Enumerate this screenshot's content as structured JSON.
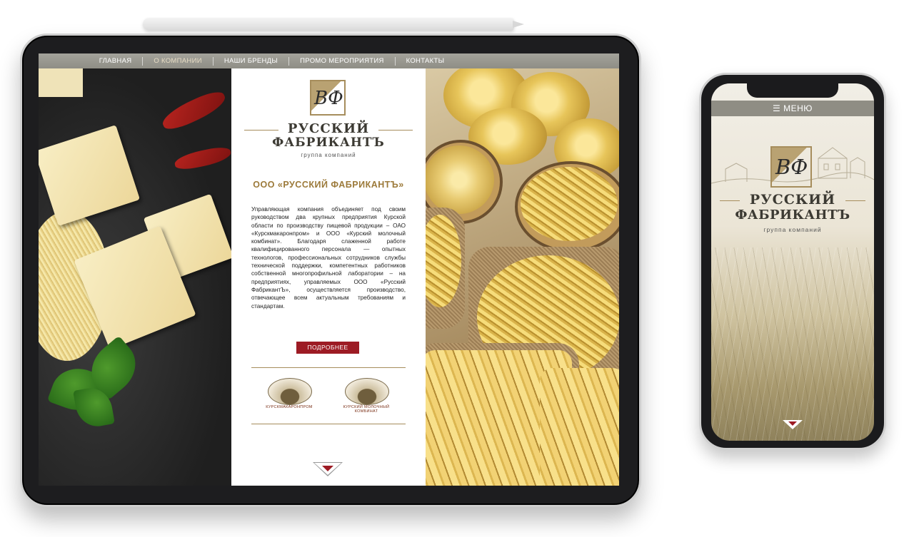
{
  "nav": {
    "items": [
      {
        "label": "ГЛАВНАЯ"
      },
      {
        "label": "О КОМПАНИИ"
      },
      {
        "label": "НАШИ БРЕНДЫ"
      },
      {
        "label": "ПРОМО МЕРОПРИЯТИЯ"
      },
      {
        "label": "КОНТАКТЫ"
      }
    ],
    "active_index": 1
  },
  "brand": {
    "monogram": "ВФ",
    "line1": "РУССКИЙ",
    "line2": "ФАБРИКАНТЪ",
    "subtitle": "группа компаний"
  },
  "about": {
    "title": "ООО «РУССКИЙ ФАБРИКАНТЪ»",
    "text": "Управляющая компания объединяет под своим руководством два крупных предприятия Курской области по производству пищевой продукции – ОАО «Курскмакаронпром» и ООО «Курский молочный комбинат». Благодаря слаженной работе квалифицированного персонала — опытных технологов, профессиональных сотрудников службы технической поддержки, компетентных работников собственной многопрофильной лаборатории – на предприятиях, управляемых ООО «Русский ФабрикантЪ», осуществляется производство, отвечающее всем актуальным требованиям и стандартам.",
    "more_button": "ПОДРОБНЕЕ"
  },
  "partners": [
    {
      "name": "КУРСКМАКАРОНПРОМ",
      "icon": "tree-emblem-icon"
    },
    {
      "name": "КУРСКИЙ МОЛОЧНЫЙ КОМБИНАТ",
      "icon": "farm-emblem-icon"
    }
  ],
  "mobile": {
    "menu_label": "☰ МЕНЮ",
    "brand_line1": "РУССКИЙ",
    "brand_line2": "ФАБРИКАНТЪ",
    "brand_subtitle": "группа компаний"
  },
  "colors": {
    "accent_red": "#9d1b24",
    "gold": "#a68d5c",
    "nav_bg": "#8f8e86"
  }
}
